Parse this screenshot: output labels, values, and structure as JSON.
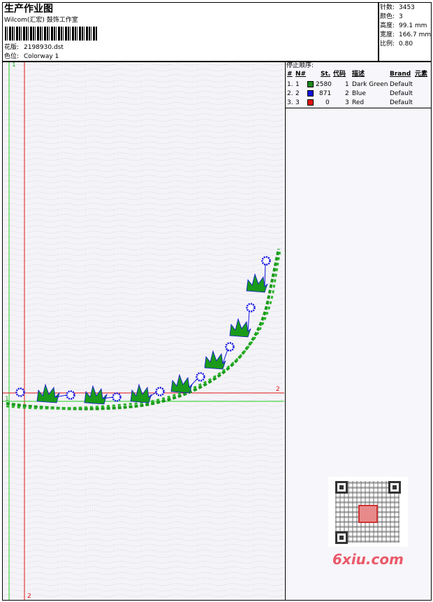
{
  "header": {
    "title": "生产作业图",
    "company": "Wilcom(汇宏) 鼓饰工作室",
    "design_label": "花版:",
    "design_value": "2198930.dst",
    "colorway_label": "色位:",
    "colorway_value": "Colorway 1"
  },
  "stats": {
    "stitches_label": "针数:",
    "stitches_value": "3453",
    "colors_label": "颜色:",
    "colors_value": "3",
    "height_label": "高度:",
    "height_value": "99.1 mm",
    "width_label": "宽度:",
    "width_value": "166.7 mm",
    "scale_label": "比例:",
    "scale_value": "0.80"
  },
  "stop_sequence": {
    "header": "停止顺序:",
    "columns": {
      "num": "#",
      "needle": "N#",
      "stitches": "St.",
      "code": "代码",
      "description": "描述",
      "brand": "Brand",
      "element": "元素"
    },
    "rows": [
      {
        "num": "1.",
        "needle": "1",
        "color": "#1a8a1a",
        "stitches": "2580",
        "code": "1",
        "description": "Dark Green",
        "brand": "Default"
      },
      {
        "num": "2.",
        "needle": "2",
        "color": "#1010dd",
        "stitches": "871",
        "code": "2",
        "description": "Blue",
        "brand": "Default"
      },
      {
        "num": "3.",
        "needle": "3",
        "color": "#dd1010",
        "stitches": "0",
        "code": "3",
        "description": "Red",
        "brand": "Default"
      }
    ]
  },
  "design_area": {
    "marker_green_top": "1",
    "marker_green_left": "1",
    "marker_red_right": "2",
    "marker_red_bottom": "2"
  },
  "watermark": {
    "site": "6xiu.com"
  },
  "colors": {
    "green": "#1a9a1a",
    "blue": "#1414e0",
    "red": "#e01414"
  }
}
